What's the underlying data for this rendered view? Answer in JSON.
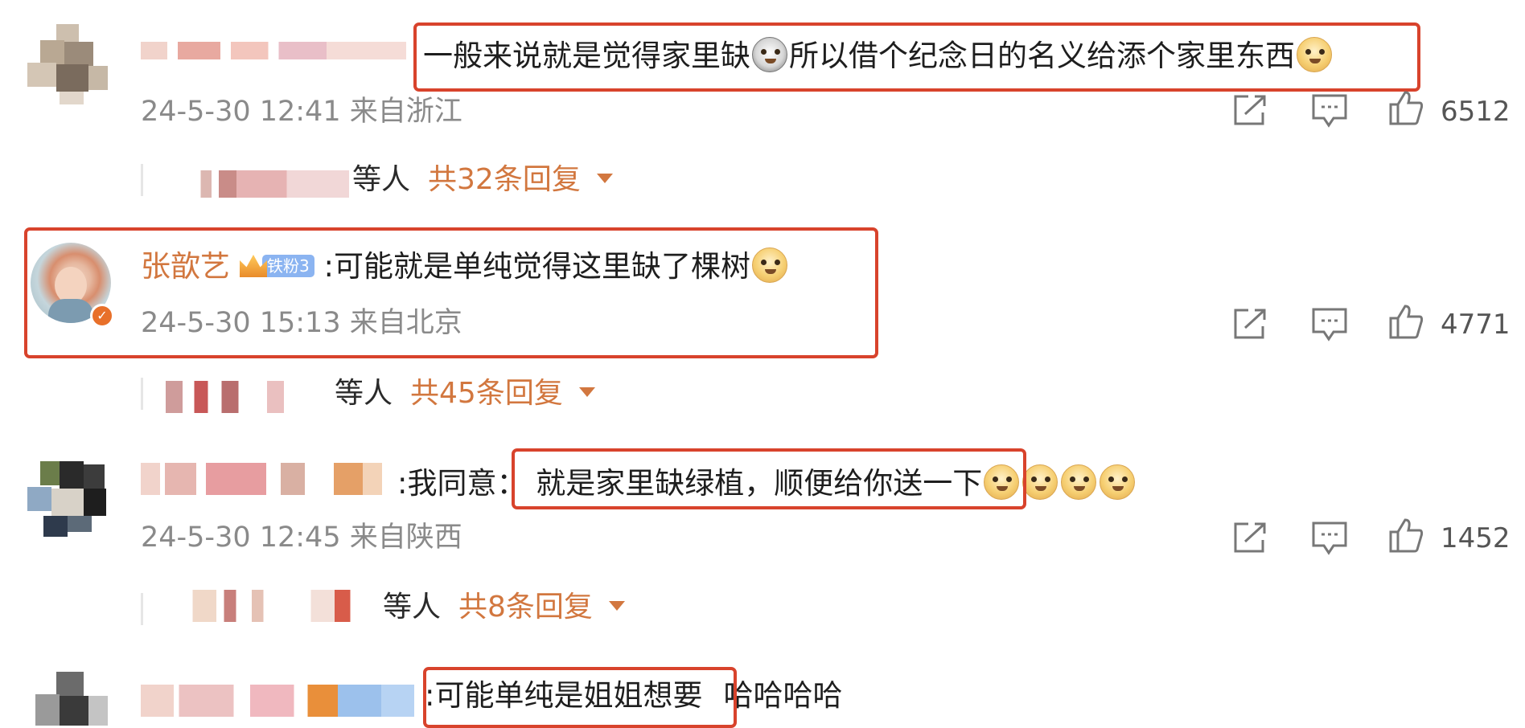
{
  "comments": [
    {
      "user_name": "",
      "text": "一般来说就是觉得家里缺",
      "text_after_emoji": "所以借个纪念日的名义给添个家里东西",
      "time": "24-5-30 12:41",
      "location": "来自浙江",
      "likes": "6512",
      "replies": {
        "who": "等人",
        "count": "共32条回复"
      }
    },
    {
      "user_name": "张歆艺",
      "badge": "铁粉3",
      "text": ":可能就是单纯觉得这里缺了棵树",
      "time": "24-5-30 15:13",
      "location": "来自北京",
      "likes": "4771",
      "replies": {
        "who": "等人",
        "count": "共45条回复"
      }
    },
    {
      "user_name": "",
      "text_prefix": ":我同意：",
      "text": "就是家里缺绿植，顺便给你送一下",
      "time": "24-5-30 12:45",
      "location": "来自陕西",
      "likes": "1452",
      "replies": {
        "who": "等人",
        "count": "共8条回复"
      }
    },
    {
      "user_name": "",
      "text": ":可能单纯是姐姐想要",
      "text_after": "哈哈哈哈"
    }
  ],
  "colors": {
    "accent": "#d2773f",
    "highlight_box": "#d8432c",
    "meta": "#8a8a8a",
    "verified": "#e8702a"
  },
  "icons": [
    "share-icon",
    "comment-icon",
    "like-icon",
    "dog-emoji",
    "husky-emoji",
    "crown-icon",
    "verified-icon"
  ]
}
